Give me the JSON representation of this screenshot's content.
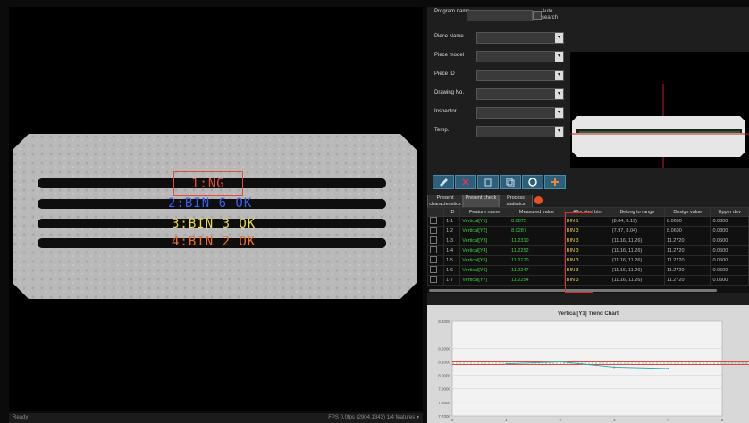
{
  "viewer": {
    "annotations": [
      {
        "text": "1:NG",
        "color": "#e84a3a"
      },
      {
        "text": "2:BIN 6 OK",
        "color": "#3a5ee8"
      },
      {
        "text": "3:BIN 3 OK",
        "color": "#e8d84a"
      },
      {
        "text": "4:BIN 2 OK",
        "color": "#f06a28"
      }
    ],
    "status_left": "Ready",
    "status_right": "FPS 0.0fps  (2904,1343)  1/4 features  ▾"
  },
  "form": {
    "program_name_label": "Program name",
    "auto_search_label": "Auto search",
    "fields": [
      {
        "label": "Piece Name"
      },
      {
        "label": "Piece model"
      },
      {
        "label": "Piece ID"
      },
      {
        "label": "Drawing No."
      },
      {
        "label": "Inspector"
      },
      {
        "label": "Temp."
      }
    ]
  },
  "toolbar": {
    "icons": [
      "edit-icon",
      "delete-icon",
      "trash-icon",
      "copy-icon",
      "refresh-icon",
      "add-icon"
    ]
  },
  "tabs": [
    {
      "label": "Present characteristics"
    },
    {
      "label": "Present check"
    },
    {
      "label": "Process statistics"
    }
  ],
  "table": {
    "columns": [
      "",
      "ID",
      "Feature name",
      "Measured value",
      "Allocated bin",
      "Belong to range",
      "Design value",
      "Upper dev"
    ],
    "rows": [
      {
        "id": "1-1",
        "name": "Vertical[Y1]",
        "measured": "8.0873",
        "bin": "BIN 1",
        "range": "(8.04, 8.19)",
        "design": "8.0690",
        "upper": "0.0300"
      },
      {
        "id": "1-2",
        "name": "Vertical[Y2]",
        "measured": "8.0287",
        "bin": "BIN 3",
        "range": "(7.97, 8.04)",
        "design": "8.0690",
        "upper": "0.0300"
      },
      {
        "id": "1-3",
        "name": "Vertical[Y3]",
        "measured": "11.2310",
        "bin": "BIN 3",
        "range": "(11.16, 11.26)",
        "design": "11.2720",
        "upper": "0.0500"
      },
      {
        "id": "1-4",
        "name": "Vertical[Y4]",
        "measured": "11.2252",
        "bin": "BIN 3",
        "range": "(11.16, 11.26)",
        "design": "11.2720",
        "upper": "0.0500"
      },
      {
        "id": "1-5",
        "name": "Vertical[Y5]",
        "measured": "11.2170",
        "bin": "BIN 3",
        "range": "(11.16, 11.26)",
        "design": "11.2720",
        "upper": "0.0500"
      },
      {
        "id": "1-6",
        "name": "Vertical[Y6]",
        "measured": "11.2247",
        "bin": "BIN 3",
        "range": "(11.16, 11.26)",
        "design": "11.2720",
        "upper": "0.0500"
      },
      {
        "id": "1-7",
        "name": "Vertical[Y7]",
        "measured": "11.2254",
        "bin": "BIN 3",
        "range": "(11.16, 11.26)",
        "design": "11.2720",
        "upper": "0.0500"
      }
    ]
  },
  "trend": {
    "title": "Vertical[Y1] Trend Chart",
    "y_ticks": [
      "8.4000",
      "8.2000",
      "8.1000",
      "8.0000",
      "7.9000",
      "7.8000",
      "7.7000"
    ],
    "x_ticks": [
      "0",
      "1",
      "2",
      "3",
      "4",
      "5"
    ],
    "values": [
      8.085,
      8.1,
      8.06,
      8.05
    ],
    "x_start": 1,
    "upper_limit": 8.099,
    "lower_limit": 8.08,
    "colors": {
      "line": "#2aa9a9",
      "upper": "#e03030",
      "lower": "#e03030",
      "mid": "#30a030"
    }
  }
}
